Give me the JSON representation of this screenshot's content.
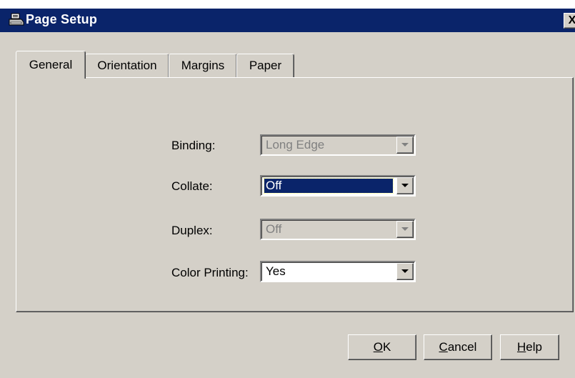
{
  "window": {
    "title": "Page Setup",
    "close_label": "X"
  },
  "tabs": [
    {
      "label": "General",
      "active": true
    },
    {
      "label": "Orientation",
      "active": false
    },
    {
      "label": "Margins",
      "active": false
    },
    {
      "label": "Paper",
      "active": false
    }
  ],
  "fields": {
    "binding": {
      "label": "Binding:",
      "value": "Long Edge",
      "enabled": false
    },
    "collate": {
      "label": "Collate:",
      "value": "Off",
      "enabled": true,
      "focused": true
    },
    "duplex": {
      "label": "Duplex:",
      "value": "Off",
      "enabled": false
    },
    "color_printing": {
      "label": "Color Printing:",
      "value": "Yes",
      "enabled": true
    }
  },
  "buttons": {
    "ok": {
      "mnemonic": "O",
      "rest": "K"
    },
    "cancel": {
      "mnemonic": "C",
      "rest": "ancel"
    },
    "help": {
      "mnemonic": "H",
      "rest": "elp"
    }
  },
  "colors": {
    "titlebar": "#0a246a",
    "face": "#d4d0c8",
    "selection": "#0a246a"
  }
}
